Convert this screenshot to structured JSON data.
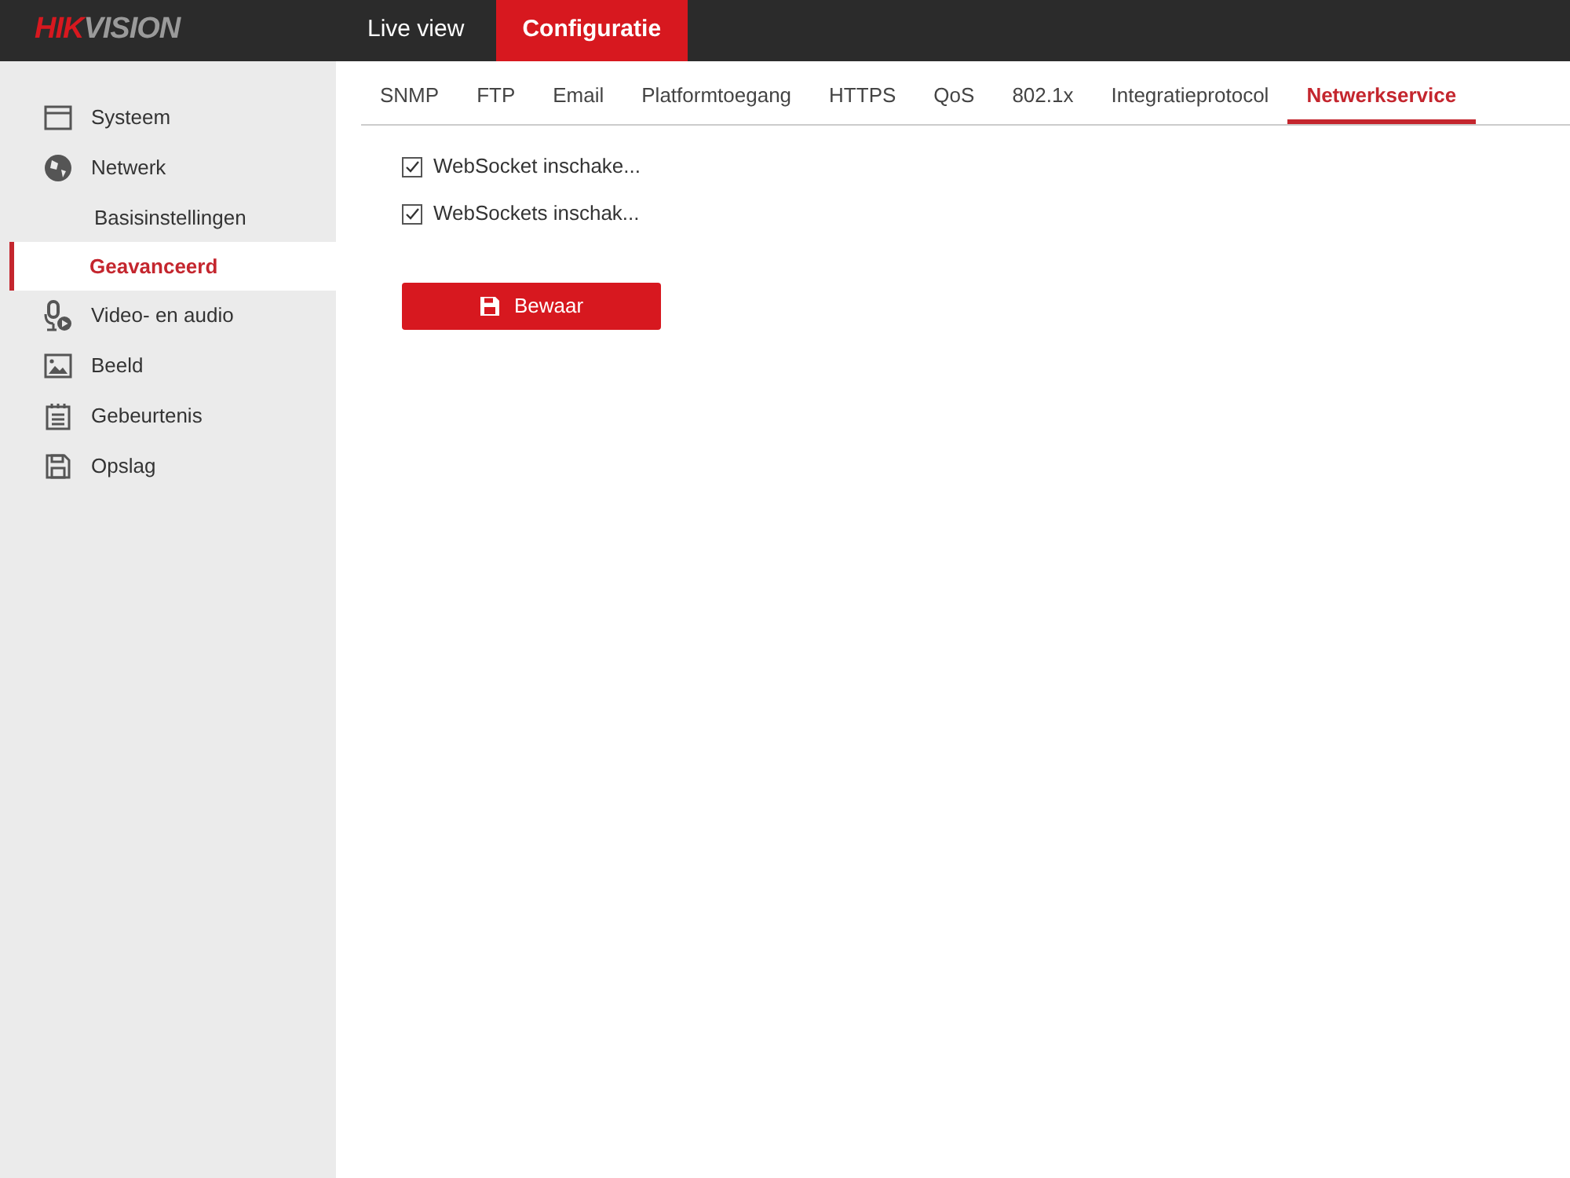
{
  "header": {
    "logo": [
      "HIK",
      "VISION"
    ],
    "nav": [
      {
        "label": "Live view",
        "selected": false
      },
      {
        "label": "Configuratie",
        "selected": true
      }
    ]
  },
  "sidebar": {
    "items": [
      {
        "label": "Systeem"
      },
      {
        "label": "Netwerk",
        "children": [
          {
            "label": "Basisinstellingen",
            "selected": false
          },
          {
            "label": "Geavanceerd",
            "selected": true
          }
        ]
      },
      {
        "label": "Video- en audio"
      },
      {
        "label": "Beeld"
      },
      {
        "label": "Gebeurtenis"
      },
      {
        "label": "Opslag"
      }
    ]
  },
  "tabs": [
    {
      "label": "SNMP",
      "selected": false
    },
    {
      "label": "FTP",
      "selected": false
    },
    {
      "label": "Email",
      "selected": false
    },
    {
      "label": "Platformtoegang",
      "selected": false
    },
    {
      "label": "HTTPS",
      "selected": false
    },
    {
      "label": "QoS",
      "selected": false
    },
    {
      "label": "802.1x",
      "selected": false
    },
    {
      "label": "Integratieprotocol",
      "selected": false
    },
    {
      "label": "Netwerkservice",
      "selected": true
    }
  ],
  "options": [
    {
      "label": "WebSocket inschake...",
      "checked": true
    },
    {
      "label": "WebSockets inschak...",
      "checked": true
    }
  ],
  "save_button": "Bewaar"
}
